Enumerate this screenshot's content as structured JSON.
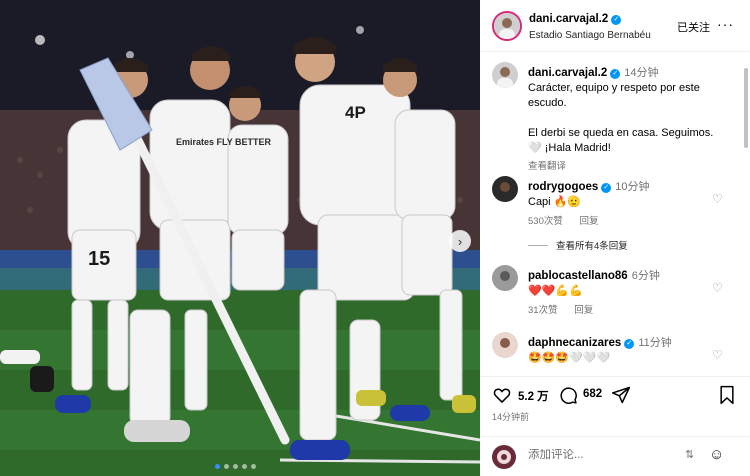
{
  "post": {
    "username": "dani.carvajal.2",
    "location": "Estadio Santiago Bernabéu",
    "follow_label": "已关注",
    "more_label": "···"
  },
  "caption": {
    "username": "dani.carvajal.2",
    "time": "14分钟",
    "text": "Carácter, equipo y respeto por este\nescudo.\n\nEl derbi se queda en casa. Seguimos.\n🤍 ¡Hala Madrid!",
    "translate_label": "查看翻译"
  },
  "comments": [
    {
      "username": "rodrygogoes",
      "verified": true,
      "time": "10分钟",
      "text": "Capi 🔥🫡",
      "likes": "530次赞",
      "reply_label": "回复",
      "view_replies": "查看所有4条回复"
    },
    {
      "username": "pablocastellano86",
      "verified": false,
      "time": "6分钟",
      "text": "❤️❤️💪💪",
      "likes": "31次赞",
      "reply_label": "回复"
    },
    {
      "username": "daphnecanizares",
      "verified": true,
      "time": "11分钟",
      "text": "🤩🤩🤩🤍🤍🤍"
    }
  ],
  "actions": {
    "likes": "5.2 万",
    "comments": "682",
    "posted": "14分钟前"
  },
  "add_comment": {
    "placeholder": "添加评论..."
  },
  "photo": {
    "jersey_numbers": [
      "15",
      "4P"
    ],
    "jersey_sponsor": "Emirates FLY BETTER"
  },
  "colors": {
    "verified": "#0095f6",
    "link": "#00376b",
    "muted": "#737373",
    "pitch": "#2f6a2a"
  },
  "icons": [
    "heart-icon",
    "comment-icon",
    "share-icon",
    "bookmark-icon",
    "more-icon",
    "emoji-icon",
    "chevron-right-icon",
    "verified-icon"
  ]
}
